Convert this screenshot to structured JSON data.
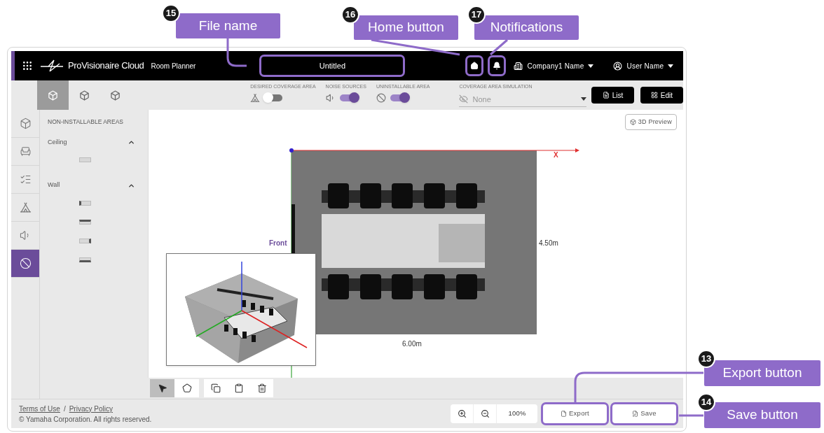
{
  "callouts": [
    {
      "number": "15",
      "label": "File name"
    },
    {
      "number": "16",
      "label": "Home button"
    },
    {
      "number": "17",
      "label": "Notifications"
    },
    {
      "number": "13",
      "label": "Export button"
    },
    {
      "number": "14",
      "label": "Save button"
    }
  ],
  "header": {
    "app_name": "ProVisionaire Cloud",
    "module": "Room Planner",
    "file_name": {
      "text": "Untitled",
      "highlighted": true
    },
    "home": {
      "highlighted": true
    },
    "notifications": {
      "highlighted": true
    },
    "company": "Company1 Name",
    "user": "User Name"
  },
  "view_tabs": [
    {
      "selected": true
    },
    {
      "selected": false
    },
    {
      "selected": false
    }
  ],
  "toggles": [
    {
      "label": "DESIRED COVERAGE AREA",
      "on": false
    },
    {
      "label": "NOISE SOURCES",
      "on": true
    },
    {
      "label": "UNINSTALLABLE AREA",
      "on": true
    }
  ],
  "simulation": {
    "label": "COVERAGE AREA SIMULATION",
    "value": "None"
  },
  "toolbar_buttons": [
    {
      "kind": "list",
      "label": "List"
    },
    {
      "kind": "edit",
      "label": "Edit"
    }
  ],
  "rail": [
    {
      "kind": "room",
      "selected": false
    },
    {
      "kind": "furniture",
      "selected": false
    },
    {
      "kind": "checklist",
      "selected": false
    },
    {
      "kind": "coverage",
      "selected": false
    },
    {
      "kind": "noise",
      "selected": false
    },
    {
      "kind": "uninstallable",
      "selected": true
    }
  ],
  "panel": {
    "title": "NON-INSTALLABLE AREAS",
    "groups": [
      {
        "name": "Ceiling",
        "expanded": true,
        "items": [
          {
            "kind": "ceiling"
          }
        ]
      },
      {
        "name": "Wall",
        "expanded": true,
        "items": [
          {
            "kind": "left"
          },
          {
            "kind": "top"
          },
          {
            "kind": "right"
          },
          {
            "kind": "bottom"
          }
        ]
      }
    ]
  },
  "canvas": {
    "preview_button": "3D Preview",
    "axis_label": "X",
    "front_label": "Front",
    "depth": "4.50m",
    "width": "6.00m"
  },
  "edit_tools": [
    {
      "kind": "select",
      "selected": true
    },
    {
      "kind": "area",
      "selected": false
    },
    {
      "kind": "copy",
      "selected": false
    },
    {
      "kind": "paste",
      "selected": false
    },
    {
      "kind": "delete",
      "selected": false
    }
  ],
  "zoom": {
    "value": "100%"
  },
  "actions": [
    {
      "kind": "export",
      "label": "Export",
      "highlighted": true
    },
    {
      "kind": "save",
      "label": "Save",
      "highlighted": true
    }
  ],
  "footer": {
    "links": [
      "Terms of Use",
      "Privacy Policy"
    ],
    "separator": "/",
    "copyright": "© Yamaha Corporation. All rights reserved."
  }
}
